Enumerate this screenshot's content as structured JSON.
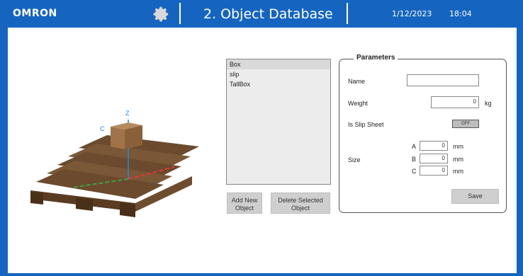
{
  "header": {
    "logo": "OMRON",
    "title": "2. Object Database",
    "date": "1/12/2023",
    "time": "18:04"
  },
  "viewer": {
    "axis_z": "Z",
    "axis_c": "C"
  },
  "object_list": {
    "items": [
      "Box",
      "slip",
      "TallBox"
    ],
    "selected_index": 0
  },
  "buttons": {
    "add_line1": "Add New",
    "add_line2": "Object",
    "delete_line1": "Delete Selected",
    "delete_line2": "Object"
  },
  "parameters": {
    "legend": "Parameters",
    "name_label": "Name",
    "name_value": "",
    "weight_label": "Weight",
    "weight_value": "0",
    "weight_unit": "kg",
    "slip_label": "Is Slip Sheet",
    "slip_toggle": "OFF",
    "size_label": "Size",
    "dim_a_label": "A",
    "dim_a_value": "0",
    "dim_b_label": "B",
    "dim_b_value": "0",
    "dim_c_label": "C",
    "dim_c_value": "0",
    "dim_unit": "mm",
    "save_label": "Save"
  },
  "colors": {
    "header_bg": "#1565c0",
    "content_bg": "#ffffff",
    "pallet_wood": "#7a5a3a",
    "axis_x": "#e53935",
    "axis_y": "#43a047",
    "axis_z": "#1e88e5"
  }
}
